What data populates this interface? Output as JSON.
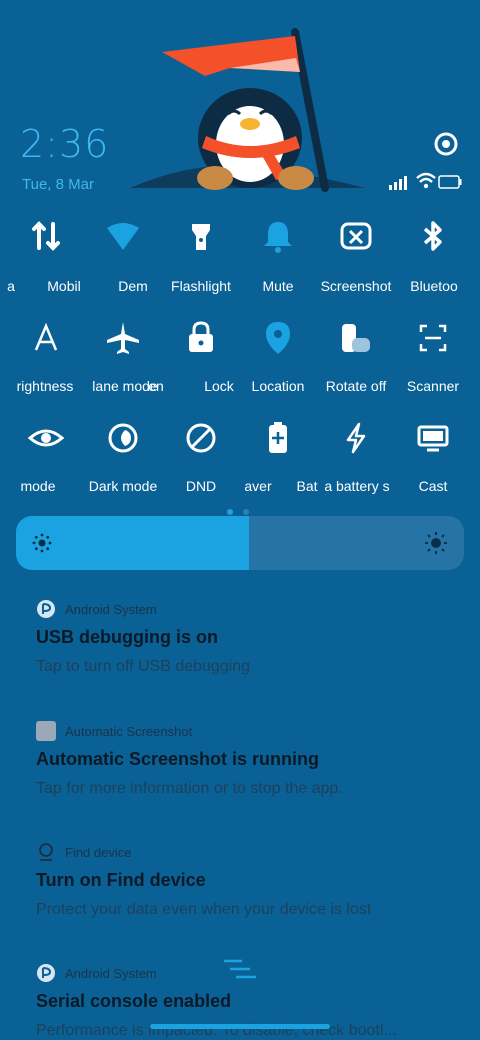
{
  "status": {
    "time": "2:36",
    "date": "Tue, 8 Mar"
  },
  "colors": {
    "background": "#0a6196",
    "accent": "#1aa3e0",
    "clock": "#3fb7f0"
  },
  "tiles_row1": [
    {
      "label": "a",
      "icon": "partial-icon"
    },
    {
      "label": "Mobil",
      "icon": "mobile-data-icon"
    },
    {
      "label": "Dem",
      "icon": "demo-icon"
    },
    {
      "label": "Flashlight",
      "icon": "flashlight-icon"
    },
    {
      "label": "Mute",
      "icon": "bell-icon"
    },
    {
      "label": "Screenshot",
      "icon": "screenshot-icon"
    },
    {
      "label": "Bluetoo",
      "icon": "bluetooth-icon"
    }
  ],
  "tiles_row2": [
    {
      "label": "rightness",
      "icon": "auto-brightness-icon"
    },
    {
      "label": "lane mode",
      "icon": "airplane-icon"
    },
    {
      "label": "en",
      "icon": "partial-icon"
    },
    {
      "label": "Lock",
      "icon": "lock-icon"
    },
    {
      "label": "Location",
      "icon": "location-icon"
    },
    {
      "label": "Rotate off",
      "icon": "rotate-icon"
    },
    {
      "label": "Scanner",
      "icon": "scanner-icon"
    }
  ],
  "tiles_row3": [
    {
      "label": "mode",
      "icon": "eye-icon"
    },
    {
      "label": "Dark mode",
      "icon": "dark-mode-icon"
    },
    {
      "label": "DND",
      "icon": "dnd-icon"
    },
    {
      "label": "aver",
      "icon": "battery-saver-icon"
    },
    {
      "label": "Bat",
      "icon": "partial-icon"
    },
    {
      "label": "a battery s",
      "icon": "bolt-icon"
    },
    {
      "label": "Cast",
      "icon": "cast-icon"
    }
  ],
  "brightness": {
    "level": 0.52
  },
  "notifications": [
    {
      "app": "Android System",
      "title": "USB debugging is on",
      "text": "Tap to turn off USB debugging",
      "icon": "android-system-icon"
    },
    {
      "app": "Automatic Screenshot",
      "title": "Automatic Screenshot is running",
      "text": "Tap for more information or to stop the app.",
      "icon": "screenshot-app-icon"
    },
    {
      "app": "Find device",
      "title": "Turn on Find device",
      "text": "Protect your data even when your device is lost",
      "icon": "find-device-icon"
    },
    {
      "app": "Android System",
      "title": "Serial console enabled",
      "text": "Performance is impacted. To disable, check bootl...",
      "icon": "android-system-icon"
    }
  ]
}
